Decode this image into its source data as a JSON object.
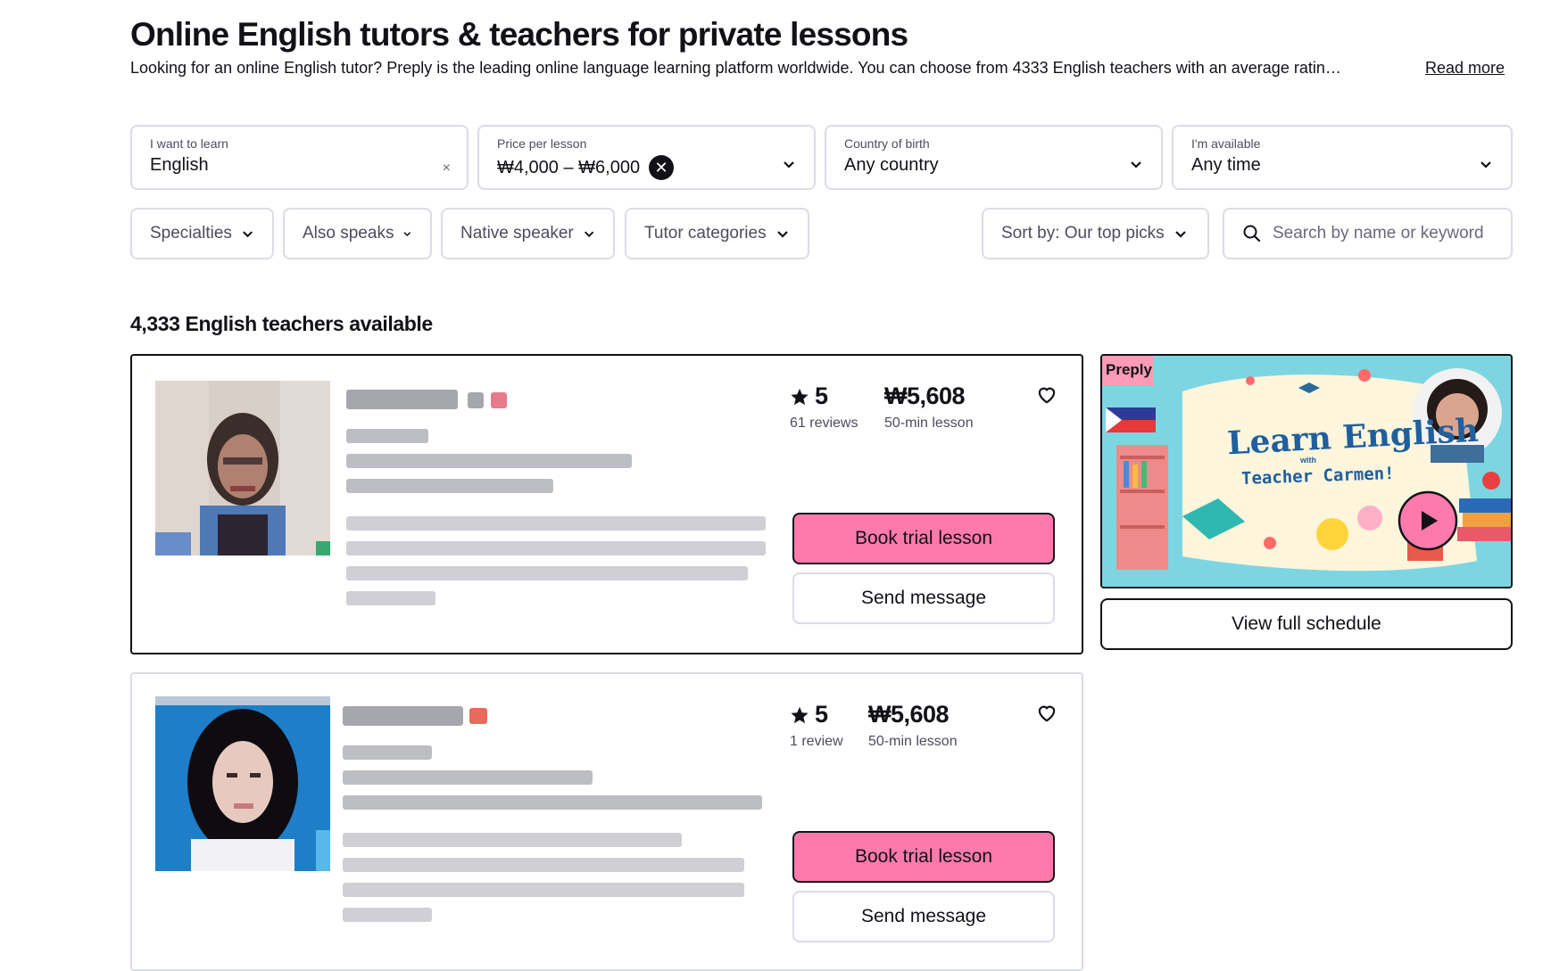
{
  "header": {
    "title": "Online English tutors & teachers for private lessons",
    "subtitle": "Looking for an online English tutor? Preply is the leading online language learning platform worldwide. You can choose from 4333 English teachers with an average ratin…",
    "read_more": "Read more"
  },
  "filters": {
    "learn": {
      "label": "I want to learn",
      "value": "English",
      "clear": "×"
    },
    "price": {
      "label": "Price per lesson",
      "value": "₩4,000 – ₩6,000",
      "clear": "✕"
    },
    "country": {
      "label": "Country of birth",
      "value": "Any country"
    },
    "availability": {
      "label": "I'm available",
      "value": "Any time"
    }
  },
  "chips": {
    "specialties": "Specialties",
    "also_speaks": "Also speaks",
    "native_speaker": "Native speaker",
    "tutor_categories": "Tutor categories",
    "sort": "Sort by: Our top picks",
    "search_placeholder": "Search by name or keyword"
  },
  "results": {
    "count": "4,333 English teachers available"
  },
  "tutors": [
    {
      "rating": "5",
      "reviews": "61 reviews",
      "price": "₩5,608",
      "lesson": "50-min lesson",
      "book_label": "Book trial lesson",
      "message_label": "Send message"
    },
    {
      "rating": "5",
      "reviews": "1 review",
      "price": "₩5,608",
      "lesson": "50-min lesson",
      "book_label": "Book trial lesson",
      "message_label": "Send message"
    }
  ],
  "video": {
    "brand": "Preply",
    "headline": "Learn English",
    "with": "with",
    "name": "Teacher Carmen!",
    "schedule_label": "View full schedule"
  },
  "icons": {
    "chevron": "chevron-down-icon",
    "star": "star-icon",
    "heart": "heart-icon",
    "search": "search-icon",
    "play": "play-icon"
  },
  "colors": {
    "accent_pink": "#ff7aac",
    "text": "#121117",
    "border": "#dcdce5"
  }
}
